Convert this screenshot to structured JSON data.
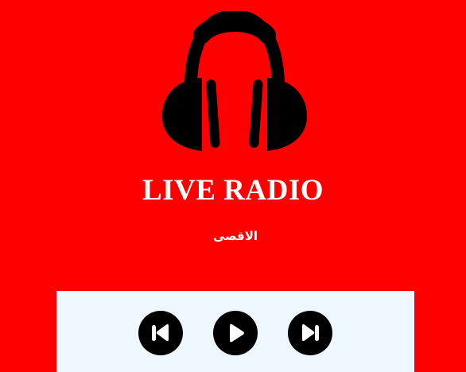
{
  "header": {
    "title": "LIVE RADIO",
    "station_name": "الاقصى"
  },
  "icons": {
    "logo": "headphones-icon",
    "previous": "skip-previous-icon",
    "play": "play-icon",
    "next": "skip-next-icon"
  },
  "colors": {
    "background": "#ff0000",
    "controls_panel": "#eef7ff",
    "buttons": "#000000",
    "text": "#ffffff"
  }
}
